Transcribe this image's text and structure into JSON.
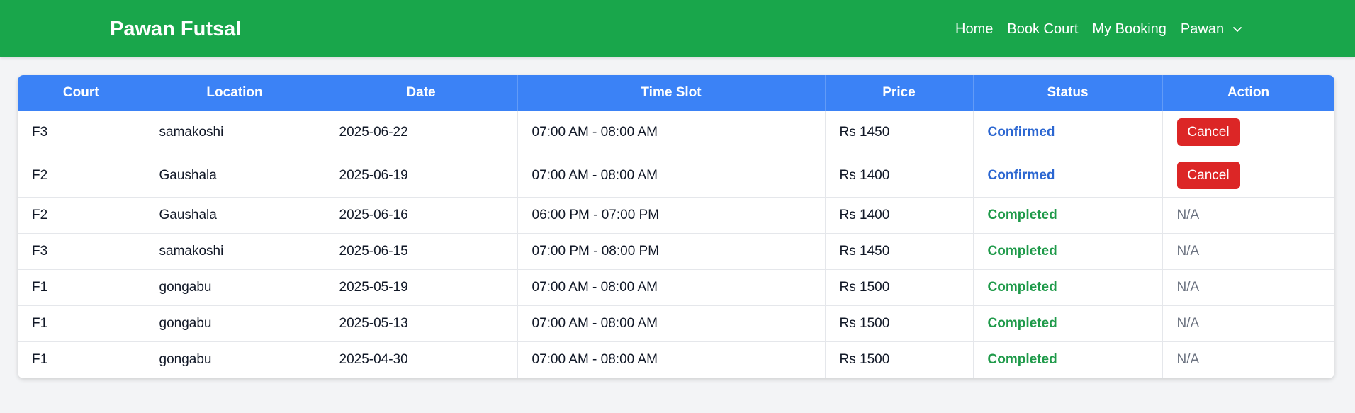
{
  "navbar": {
    "brand": "Pawan Futsal",
    "links": [
      "Home",
      "Book Court",
      "My Booking"
    ],
    "user_name": "Pawan",
    "user_icon": "chevron-down-icon",
    "background": "#19a64b"
  },
  "table": {
    "header_color": "#3b82f6",
    "columns": [
      "Court",
      "Location",
      "Date",
      "Time Slot",
      "Price",
      "Status",
      "Action"
    ],
    "rows": [
      {
        "court": "F3",
        "location": "samakoshi",
        "date": "2025-06-22",
        "time_slot": "07:00 AM - 08:00 AM",
        "price": "Rs 1450",
        "status": "Confirmed",
        "action": "Cancel"
      },
      {
        "court": "F2",
        "location": "Gaushala",
        "date": "2025-06-19",
        "time_slot": "07:00 AM - 08:00 AM",
        "price": "Rs 1400",
        "status": "Confirmed",
        "action": "Cancel"
      },
      {
        "court": "F2",
        "location": "Gaushala",
        "date": "2025-06-16",
        "time_slot": "06:00 PM - 07:00 PM",
        "price": "Rs 1400",
        "status": "Completed",
        "action": "N/A"
      },
      {
        "court": "F3",
        "location": "samakoshi",
        "date": "2025-06-15",
        "time_slot": "07:00 PM - 08:00 PM",
        "price": "Rs 1450",
        "status": "Completed",
        "action": "N/A"
      },
      {
        "court": "F1",
        "location": "gongabu",
        "date": "2025-05-19",
        "time_slot": "07:00 AM - 08:00 AM",
        "price": "Rs 1500",
        "status": "Completed",
        "action": "N/A"
      },
      {
        "court": "F1",
        "location": "gongabu",
        "date": "2025-05-13",
        "time_slot": "07:00 AM - 08:00 AM",
        "price": "Rs 1500",
        "status": "Completed",
        "action": "N/A"
      },
      {
        "court": "F1",
        "location": "gongabu",
        "date": "2025-04-30",
        "time_slot": "07:00 AM - 08:00 AM",
        "price": "Rs 1500",
        "status": "Completed",
        "action": "N/A"
      }
    ]
  }
}
